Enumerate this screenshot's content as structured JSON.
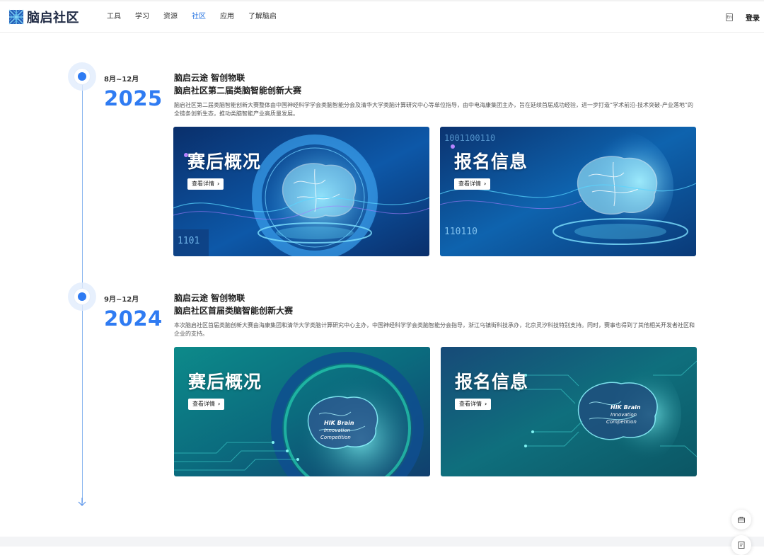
{
  "header": {
    "logo_text": "脑启社区",
    "nav": [
      {
        "label": "工具",
        "active": false
      },
      {
        "label": "学习",
        "active": false
      },
      {
        "label": "资源",
        "active": false
      },
      {
        "label": "社区",
        "active": true
      },
      {
        "label": "应用",
        "active": false
      },
      {
        "label": "了解脑启",
        "active": false
      }
    ],
    "lang_label": "En",
    "login_label": "登录"
  },
  "events": [
    {
      "date_range": "8月~12月",
      "year": "2025",
      "title_line1": "脑启云途 智创物联",
      "title_line2": "脑启社区第二届类脑智能创新大赛",
      "description": "脑启社区第二届类脑智能创新大赛整体由中国神经科学学会类脑智能分会及清华大学类脑计算研究中心等单位指导，由中电海康集团主办，旨在延续首届成功经验，进一步打造“学术前沿-技术突破-产业落地”的全链条创新生态，推动类脑智能产业高质量发展。",
      "cards": [
        {
          "heading": "赛后概况",
          "button": "查看详情",
          "ring_text": "2025 The Second Intelligence Innovation Competition and Award Ceremony"
        },
        {
          "heading": "报名信息",
          "button": "查看详情"
        }
      ]
    },
    {
      "date_range": "9月~12月",
      "year": "2024",
      "title_line1": "脑启云途 智创物联",
      "title_line2": "脑启社区首届类脑智能创新大赛",
      "description": "本次脑启社区首届类脑创新大赛由海康集团和清华大学类脑计算研究中心主办，中国神经科学学会类脑智能分会指导，浙江乌镇街科技承办，北京灵汐科技特别支持。同时，赛事也得到了其他相关开发者社区和企业的支持。",
      "cards": [
        {
          "heading": "赛后概况",
          "button": "查看详情",
          "ring_text": "2024 The First Brain Intelligence Innovation Competition and Award Ceremony",
          "brand": [
            "HIK Brain",
            "Innovation",
            "Competition"
          ]
        },
        {
          "heading": "报名信息",
          "button": "查看详情",
          "brand": [
            "HIK Brain",
            "Innovation",
            "Competition"
          ]
        }
      ]
    }
  ],
  "colors": {
    "accent": "#2f7bf2",
    "nav_active": "#1f6fe0",
    "card_2025_bg": "#0b3a7a",
    "card_2024_bg": "#0c6f78"
  },
  "icons": [
    "logo-mark-icon",
    "language-icon",
    "arrow-down-icon",
    "chevron-right-icon",
    "briefcase-icon",
    "feedback-icon"
  ]
}
